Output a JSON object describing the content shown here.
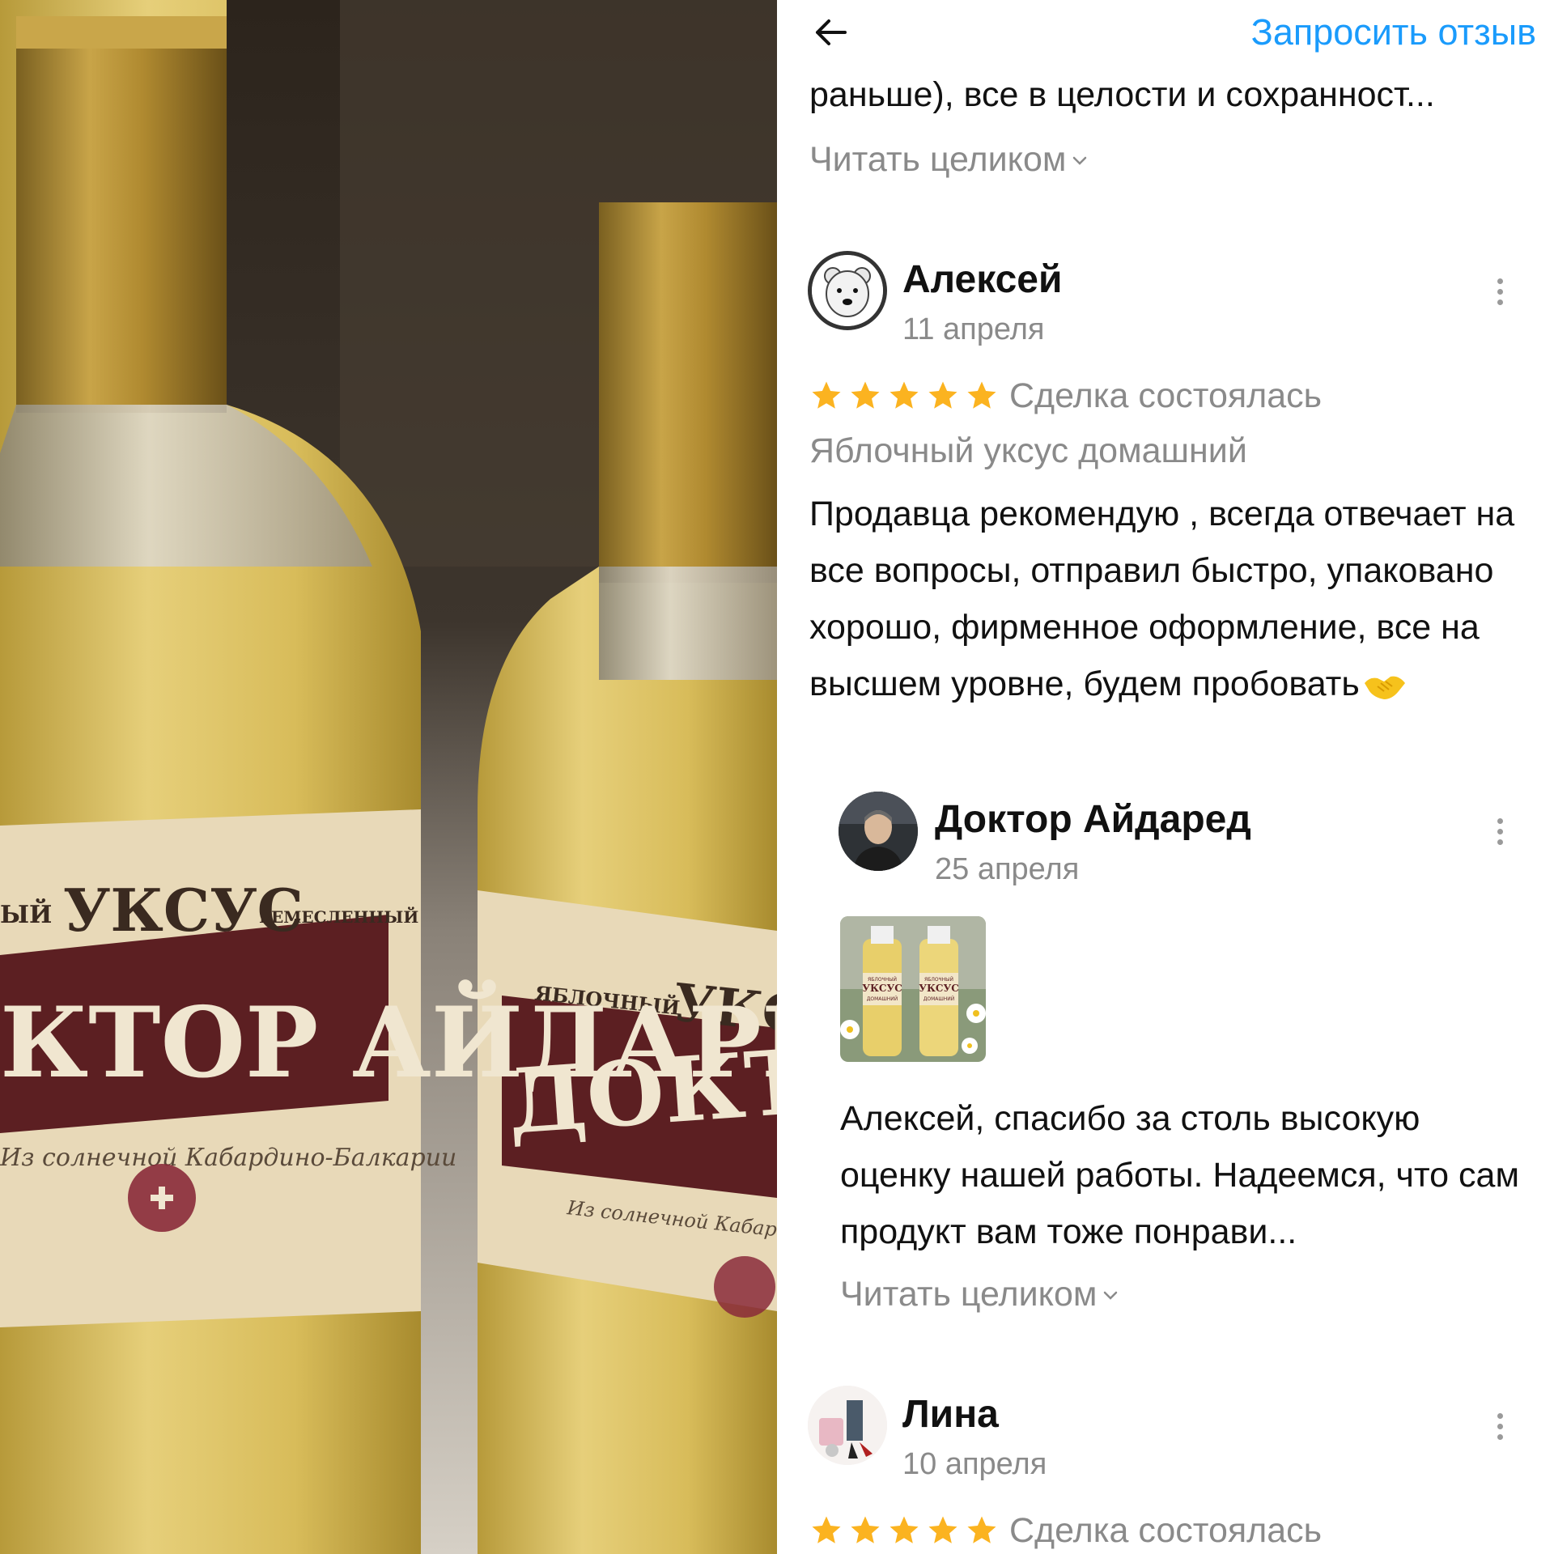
{
  "photo": {
    "label_top_left": "ЫЙ",
    "label_word": "УКСУС",
    "label_craft": "РЕМЕСЛЕННЫЙ",
    "label_brand_left": "КТОР АЙДАРЕД",
    "label_script_left": "Из солнечной Кабардино-Балкарии",
    "label_apple_right": "ЯБЛОЧНЫЙ",
    "label_word_right": "УКС",
    "label_brand_right": "ДОКТОР А",
    "label_script_right": "Из солнечной Кабар"
  },
  "header": {
    "back_icon": "arrow-left-icon",
    "request_review_label": "Запросить отзыв"
  },
  "prev_review": {
    "tail_text": "раньше), все в целости и сохранност...",
    "read_more": "Читать целиком"
  },
  "review1": {
    "author": "Алексей",
    "date": "11 апреля",
    "rating": 5,
    "deal_status": "Сделка состоялась",
    "product": "Яблочный уксус домашний",
    "text": "Продавца рекомендую , всегда отвечает на все вопросы, отправил быстро, упаковано хорошо, фирменное оформление, все на высшем уровне, будем пробовать"
  },
  "reply1": {
    "author": "Доктор Айдаред",
    "date": "25 апреля",
    "thumb_label_1": "ЯБЛОЧНЫЙ",
    "thumb_label_2": "УКСУС",
    "thumb_label_3": "ДОМАШНИЙ",
    "text": "Алексей, спасибо за столь высокую оценку нашей работы. Надеемся, что сам продукт вам тоже понрави...",
    "read_more": "Читать целиком"
  },
  "review2": {
    "author": "Лина",
    "date": "10 апреля",
    "rating": 5,
    "deal_status": "Сделка состоялась"
  },
  "colors": {
    "accent": "#1a9bfc",
    "star": "#fbb320",
    "muted": "#8a8a8a"
  }
}
